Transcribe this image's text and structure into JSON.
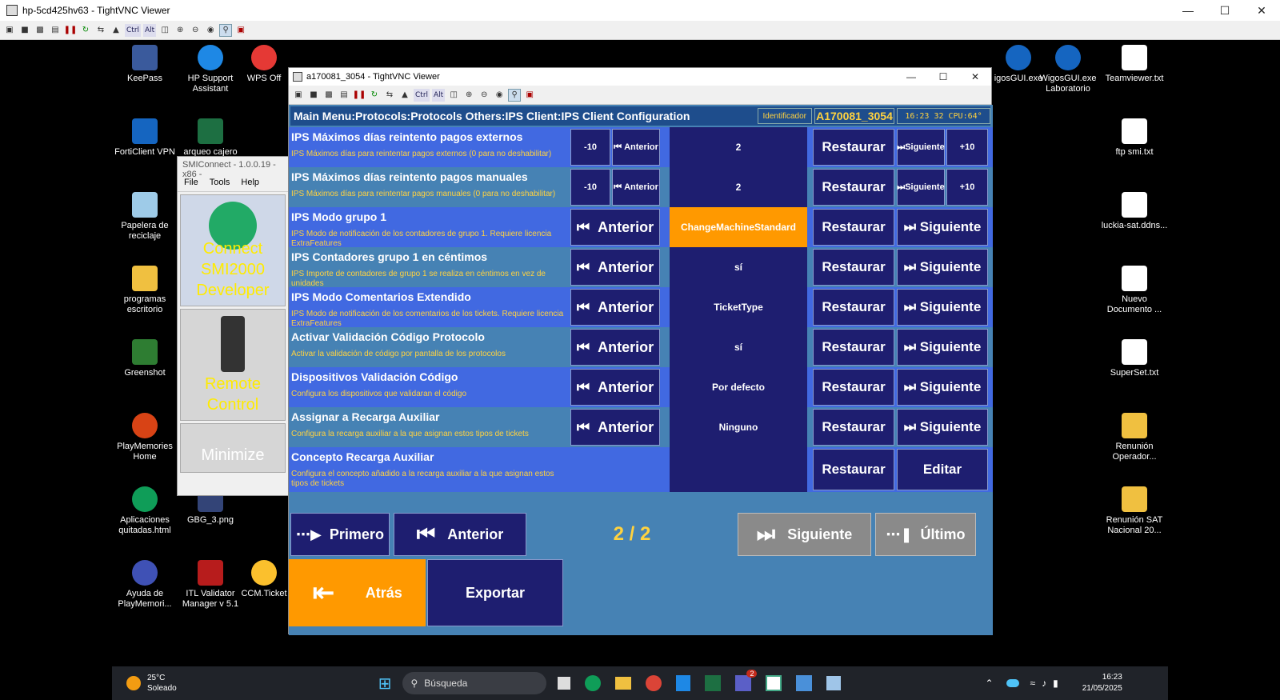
{
  "outer": {
    "title": "hp-5cd425hv63 - TightVNC Viewer"
  },
  "toolbar": {
    "ctrl": "Ctrl",
    "alt": "Alt"
  },
  "desktop_icons": [
    {
      "label": "KeePass"
    },
    {
      "label": "HP Support Assistant"
    },
    {
      "label": "WPS Off"
    },
    {
      "label": "FortiClient VPN"
    },
    {
      "label": "arqueo cajero"
    },
    {
      "label": "Papelera de reciclaje"
    },
    {
      "label": "programas escritorio"
    },
    {
      "label": "Greenshot"
    },
    {
      "label": "PlayMemories Home"
    },
    {
      "label": "Aplicaciones quitadas.html"
    },
    {
      "label": "GBG_3.png"
    },
    {
      "label": "Ayuda de PlayMemori..."
    },
    {
      "label": "ITL Validator Manager v 5.1"
    },
    {
      "label": "CCM.Ticket"
    },
    {
      "label": "igosGUI.exe"
    },
    {
      "label": "WigosGUI.exe Laboratorio"
    },
    {
      "label": "Teamviewer.txt"
    },
    {
      "label": "ftp smi.txt"
    },
    {
      "label": "luckia-sat.ddns..."
    },
    {
      "label": "Nuevo Documento ..."
    },
    {
      "label": "SuperSet.txt"
    },
    {
      "label": "Renunión Operador..."
    },
    {
      "label": "Renunión SAT Nacional 20..."
    }
  ],
  "smi": {
    "title": "SMIConnect - 1.0.0.19 - x86 -",
    "menu": [
      "File",
      "Tools",
      "Help"
    ],
    "tile1": "Connect SMI2000 Developer",
    "tile2": "Remote Control",
    "tile3": "Minimize"
  },
  "inner": {
    "title": "a170081_3054 - TightVNC Viewer"
  },
  "header": {
    "path": "Main Menu:Protocols:Protocols Others:IPS Client:IPS Client Configuration",
    "id_label": "Identificador",
    "id_value": "A170081_3054",
    "clock": "16:23 32 CPU:64°"
  },
  "rows": [
    {
      "name": "IPS Máximos días reintento pagos externos",
      "desc": "IPS Máximos días para reintentar pagos externos (0 para no deshabilitar)",
      "value": "2",
      "minus": "-10",
      "prev": "Anterior",
      "restore": "Restaurar",
      "next": "Siguiente",
      "plus": "+10"
    },
    {
      "name": "IPS Máximos días reintento pagos manuales",
      "desc": "IPS Máximos días para reintentar pagos manuales (0 para no deshabilitar)",
      "value": "2",
      "minus": "-10",
      "prev": "Anterior",
      "restore": "Restaurar",
      "next": "Siguiente",
      "plus": "+10"
    },
    {
      "name": "IPS Modo grupo 1",
      "desc": "IPS Modo de notificación de los contadores de grupo 1. Requiere licencia ExtraFeatures",
      "value": "ChangeMachineStandard",
      "prev": "Anterior",
      "restore": "Restaurar",
      "next": "Siguiente"
    },
    {
      "name": "IPS Contadores grupo 1 en céntimos",
      "desc": "IPS Importe de contadores de grupo 1 se realiza en céntimos en vez de unidades",
      "value": "sí",
      "prev": "Anterior",
      "restore": "Restaurar",
      "next": "Siguiente"
    },
    {
      "name": "IPS Modo Comentarios Extendido",
      "desc": "IPS Modo de notificación de los comentarios de los tickets. Requiere licencia ExtraFeatures",
      "value": "TicketType",
      "prev": "Anterior",
      "restore": "Restaurar",
      "next": "Siguiente"
    },
    {
      "name": "Activar Validación Código Protocolo",
      "desc": "Activar la validación de código por pantalla de los protocolos",
      "value": "sí",
      "prev": "Anterior",
      "restore": "Restaurar",
      "next": "Siguiente"
    },
    {
      "name": "Dispositivos Validación Código",
      "desc": "Configura los dispositivos que validaran el código",
      "value": "Por defecto",
      "prev": "Anterior",
      "restore": "Restaurar",
      "next": "Siguiente"
    },
    {
      "name": "Assignar a Recarga Auxiliar",
      "desc": "Configura la recarga auxiliar a la que asignan estos tipos de tickets",
      "value": "Ninguno",
      "prev": "Anterior",
      "restore": "Restaurar",
      "next": "Siguiente"
    },
    {
      "name": "Concepto Recarga Auxiliar",
      "desc": "Configura el concepto añadido a la recarga auxiliar a la que asignan estos tipos de tickets",
      "restore": "Restaurar",
      "edit": "Editar"
    }
  ],
  "pager": {
    "first": "Primero",
    "prev": "Anterior",
    "page": "2 / 2",
    "next": "Siguiente",
    "last": "Último",
    "back": "Atrás",
    "export": "Exportar"
  },
  "taskbar": {
    "temp": "25°C",
    "weather": "Soleado",
    "search": "Búsqueda",
    "badge": "2",
    "time": "16:23",
    "date": "21/05/2025"
  }
}
